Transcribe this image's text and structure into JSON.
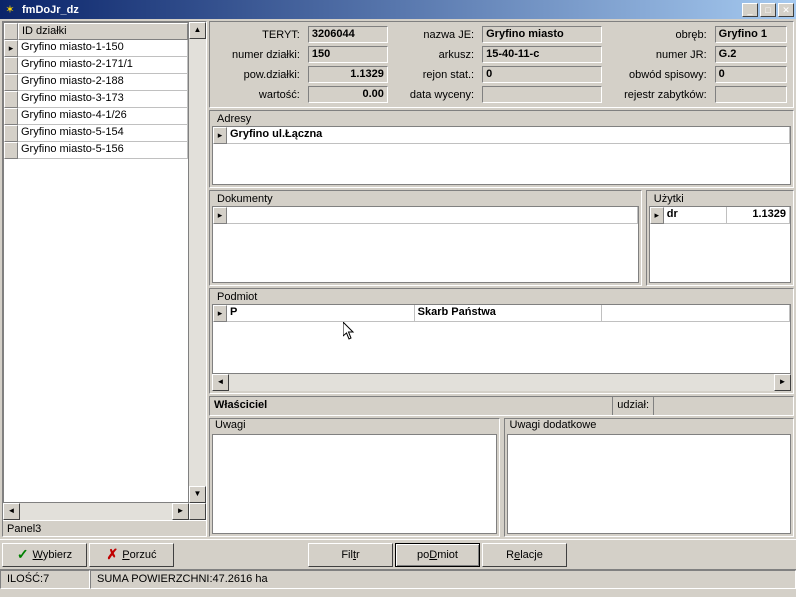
{
  "window": {
    "title": "fmDoJr_dz"
  },
  "left_grid": {
    "header": "ID działki",
    "rows": [
      "Gryfino miasto-1-150",
      "Gryfino miasto-2-171/1",
      "Gryfino miasto-2-188",
      "Gryfino miasto-3-173",
      "Gryfino miasto-4-1/26",
      "Gryfino miasto-5-154",
      "Gryfino miasto-5-156"
    ],
    "panel3": "Panel3"
  },
  "info": {
    "teryt_label": "TERYT:",
    "teryt": "3206044",
    "nazwaJE_label": "nazwa JE:",
    "nazwaJE": "Gryfino miasto",
    "obreb_label": "obręb:",
    "obreb": "Gryfino 1",
    "numer_dzialki_label": "numer działki:",
    "numer_dzialki": "150",
    "arkusz_label": "arkusz:",
    "arkusz": "15-40-11-c",
    "numerJR_label": "numer JR:",
    "numerJR": "G.2",
    "pow_dzialki_label": "pow.działki:",
    "pow_dzialki": "1.1329",
    "rejon_stat_label": "rejon stat.:",
    "rejon_stat": "0",
    "obwod_label": "obwód spisowy:",
    "obwod": "0",
    "wartosc_label": "wartość:",
    "wartosc": "0.00",
    "data_wyceny_label": "data wyceny:",
    "data_wyceny": "",
    "rejestr_label": "rejestr zabytków:",
    "rejestr": ""
  },
  "adresy": {
    "label": "Adresy",
    "row": "Gryfino  ul.Łączna"
  },
  "dokumenty": {
    "label": "Dokumenty",
    "row": ""
  },
  "uzytki": {
    "label": "Użytki",
    "col1": "dr",
    "col2": "1.1329"
  },
  "podmiot": {
    "label": "Podmiot",
    "col1": "P",
    "col2": "Skarb Państwa"
  },
  "wlasciciel": {
    "label": "Właściciel",
    "udzial_label": "udział:",
    "udzial": ""
  },
  "uwagi": {
    "label": "Uwagi",
    "dodatkowe_label": "Uwagi dodatkowe"
  },
  "buttons": {
    "wybierz": "Wybierz",
    "porzuc": "Porzuć",
    "filtr": "Filtr",
    "podmiot": "poDmiot",
    "relacje": "Relacje"
  },
  "status": {
    "ilosc": "ILOŚĆ:7",
    "suma": "SUMA POWIERZCHNI:47.2616  ha"
  }
}
